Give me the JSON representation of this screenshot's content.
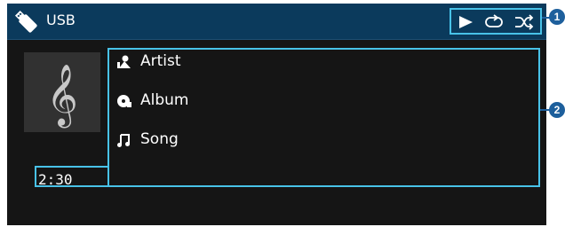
{
  "header": {
    "source": "USB",
    "source_icon": "usb-stick-icon",
    "status_icons": [
      "play-icon",
      "repeat-icon",
      "shuffle-icon"
    ]
  },
  "album_art": {
    "icon": "treble-clef-icon"
  },
  "track_info": [
    {
      "icon": "artist-icon",
      "label": "Artist"
    },
    {
      "icon": "album-icon",
      "label": "Album"
    },
    {
      "icon": "song-icon",
      "label": "Song"
    }
  ],
  "playback": {
    "elapsed_time": "2:30"
  },
  "callouts": {
    "status": "1",
    "info": "2"
  },
  "colors": {
    "header": "#0b3a5c",
    "screen": "#151515",
    "highlight": "#48c2e8",
    "callout": "#1d5f9c"
  }
}
